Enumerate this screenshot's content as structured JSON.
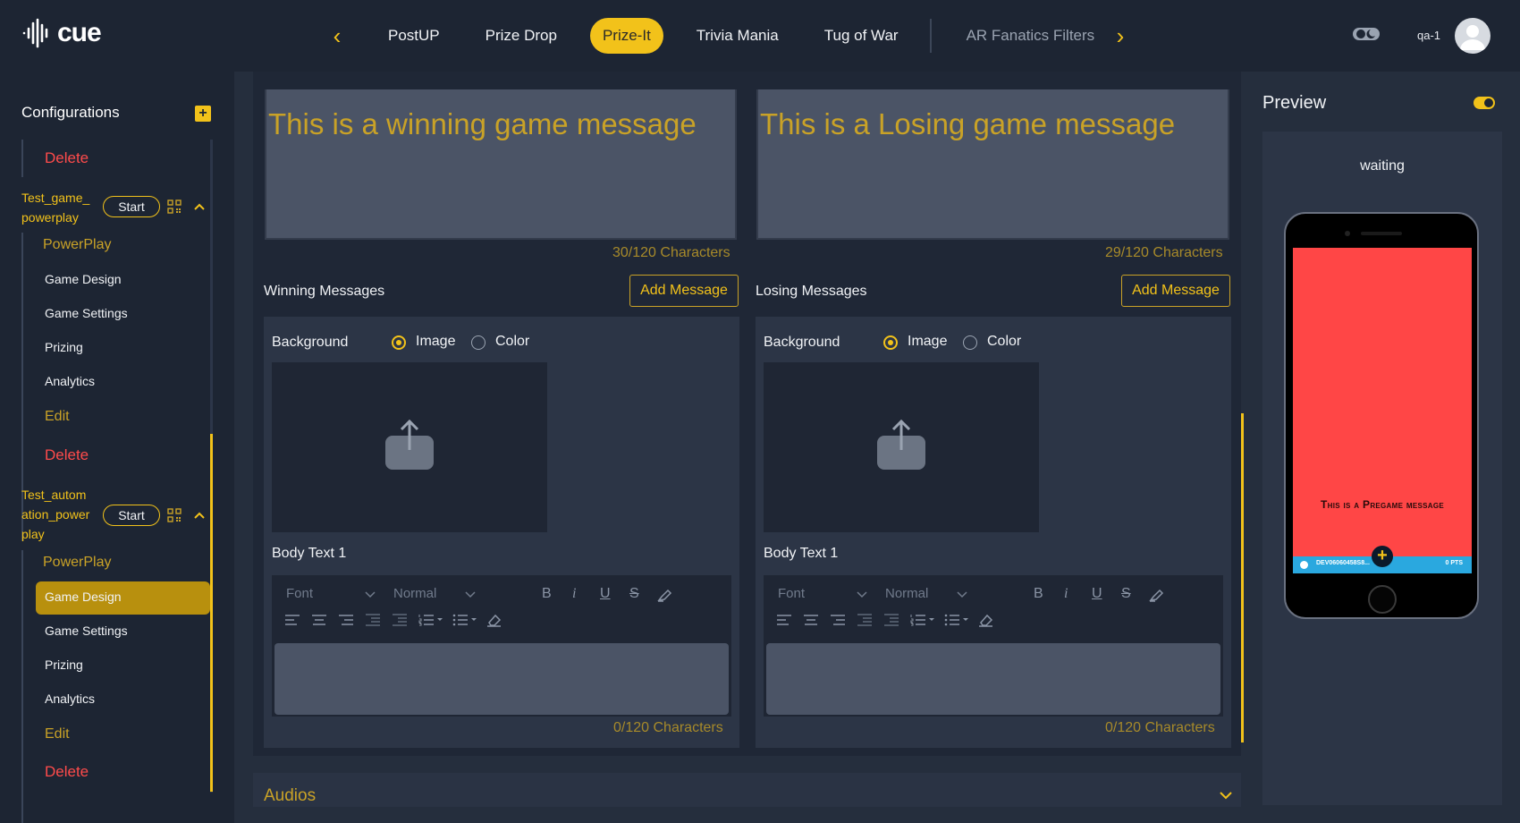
{
  "header": {
    "logo_text": "cue",
    "tabs": [
      {
        "label": "PostUP"
      },
      {
        "label": "Prize Drop"
      },
      {
        "label": "Prize-It"
      },
      {
        "label": "Trivia Mania"
      },
      {
        "label": "Tug of War"
      },
      {
        "label": "AR Fanatics Filters"
      }
    ],
    "prev_arrow": "‹",
    "next_arrow": "›",
    "user": "qa-1"
  },
  "sidebar": {
    "title": "Configurations",
    "add_icon": "+",
    "delete_top": "Delete",
    "game1": {
      "name": "Test_game_ powerplay",
      "start": "Start",
      "category": "PowerPlay",
      "items": [
        "Game Design",
        "Game Settings",
        "Prizing",
        "Analytics"
      ],
      "edit": "Edit",
      "delete": "Delete"
    },
    "game2": {
      "name": "Test_autom ation_power play",
      "start": "Start",
      "category": "PowerPlay",
      "items": [
        "Game Design",
        "Game Settings",
        "Prizing",
        "Analytics"
      ],
      "edit": "Edit",
      "delete": "Delete"
    }
  },
  "main": {
    "winning_text": "This is a winning game message",
    "losing_text": "This is a Losing game message",
    "winning_count": "30/120 Characters",
    "losing_count": "29/120 Characters",
    "winning_label": "Winning Messages",
    "losing_label": "Losing Messages",
    "add_message": "Add Message",
    "background_label": "Background",
    "image_option": "Image",
    "color_option": "Color",
    "body_text_label": "Body Text 1",
    "font_select": "Font",
    "size_select": "Normal",
    "bold": "B",
    "italic": "i",
    "underline": "U",
    "strike": "S",
    "body_count": "0/120 Characters",
    "audios_label": "Audios"
  },
  "preview": {
    "title": "Preview",
    "status": "waiting",
    "pregame_message": "This is a Pregame message",
    "bar_id": "DEV06060458S8...",
    "bar_pts": "0 PTS"
  },
  "colors": {
    "accent": "#f2c21a",
    "danger": "#ff4b4b",
    "preview_bg": "#ff4646"
  }
}
